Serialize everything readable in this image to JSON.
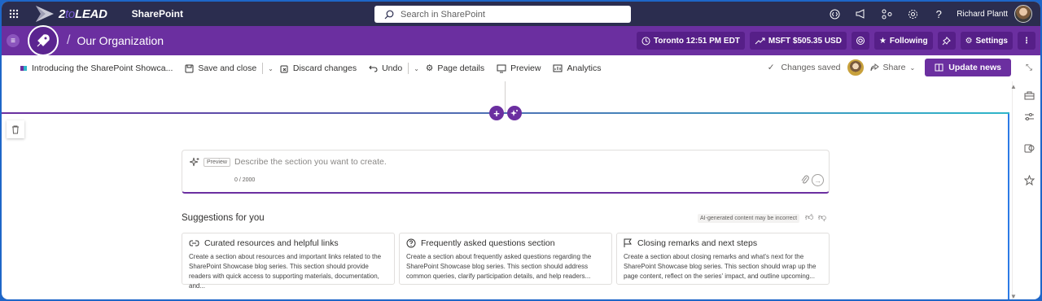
{
  "suite_bar": {
    "brand_name": "2toLEAD",
    "brand_prefix": "2",
    "brand_to": "to",
    "brand_suffix": "LEAD",
    "app_title": "SharePoint",
    "search_placeholder": "Search in SharePoint",
    "user_name": "Richard Plantt",
    "icons": [
      "code-icon",
      "megaphone-icon",
      "share-network-icon",
      "settings-icon",
      "help-icon"
    ]
  },
  "hub_bar": {
    "title": "Our Organization",
    "separator": "/",
    "time_label": "Toronto 12:51 PM EDT",
    "stock_label": "MSFT $505.35 USD",
    "following_label": "Following",
    "settings_label": "Settings"
  },
  "command_bar": {
    "page_name": "Introducing the SharePoint Showca...",
    "save_close": "Save and close",
    "discard": "Discard changes",
    "undo": "Undo",
    "page_details": "Page details",
    "preview": "Preview",
    "analytics": "Analytics",
    "changes_saved": "Changes saved",
    "share": "Share",
    "update_news": "Update news"
  },
  "prompt": {
    "preview_tag": "Preview",
    "placeholder": "Describe the section you want to create.",
    "char_count": "0 / 2000"
  },
  "suggestions": {
    "title": "Suggestions for you",
    "ai_note": "AI-generated content may be incorrect",
    "cards": [
      {
        "icon": "link-icon",
        "title": "Curated resources and helpful links",
        "body": "Create a section about resources and important links related to the SharePoint Showcase blog series. This section should provide readers with quick access to supporting materials, documentation, and..."
      },
      {
        "icon": "question-icon",
        "title": "Frequently asked questions section",
        "body": "Create a section about frequently asked questions regarding the SharePoint Showcase blog series. This section should address common queries, clarify participation details, and help readers..."
      },
      {
        "icon": "flag-icon",
        "title": "Closing remarks and next steps",
        "body": "Create a section about closing remarks and what's next for the SharePoint Showcase blog series. This section should wrap up the page content, reflect on the series' impact, and outline upcoming..."
      }
    ]
  },
  "colors": {
    "suite_bg": "#2b2d4f",
    "hub_purple": "#6b2fa0",
    "accent_blue": "#2c7be5",
    "accent_teal": "#2fb6c9"
  }
}
